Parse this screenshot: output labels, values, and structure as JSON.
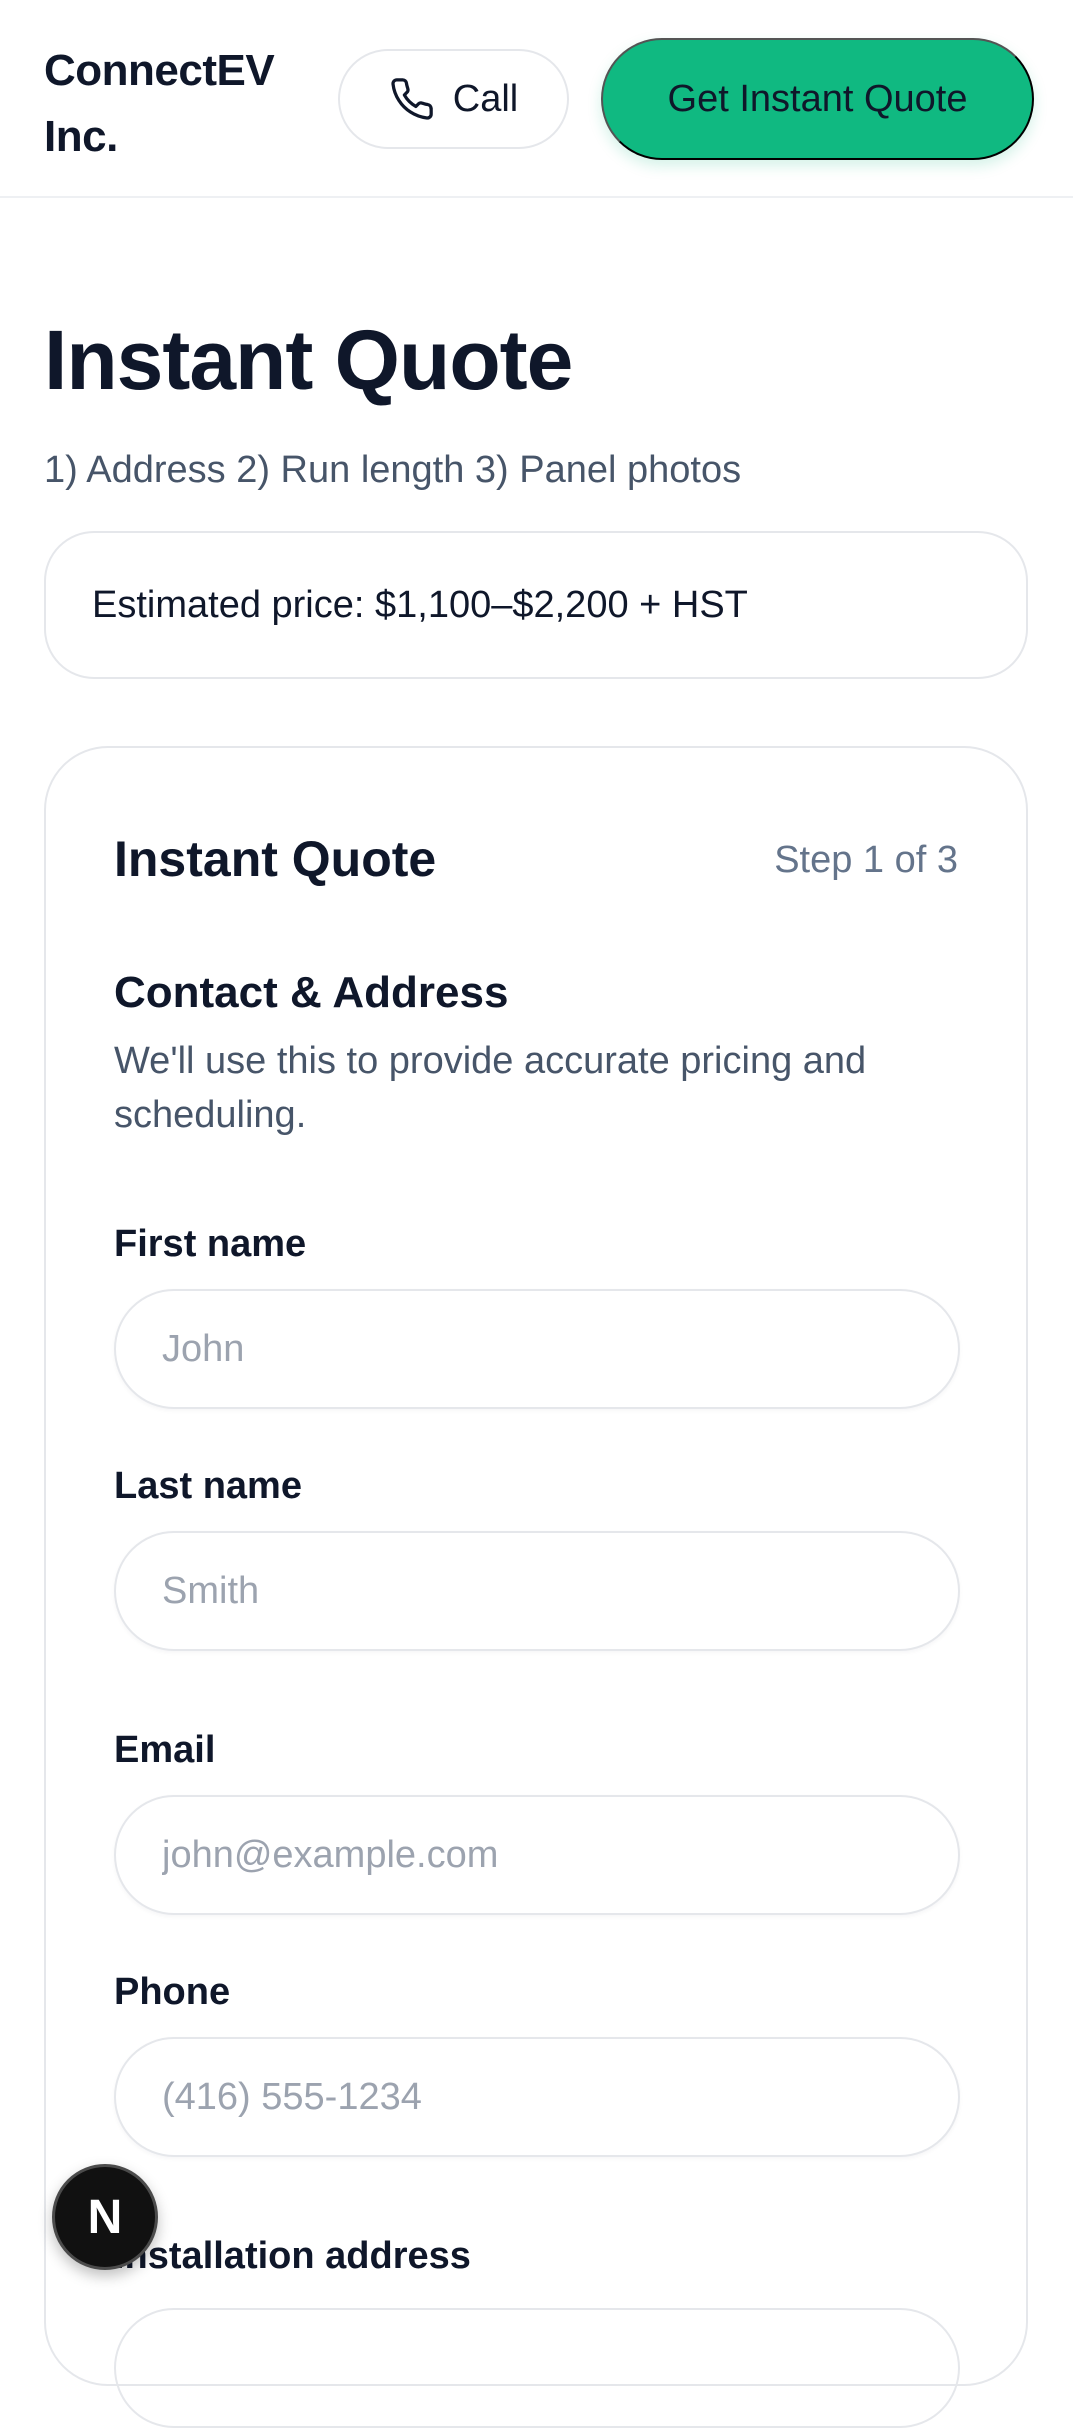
{
  "header": {
    "brand": "ConnectEV Inc.",
    "call_label": "Call",
    "quote_label": "Get Instant Quote"
  },
  "page": {
    "title": "Instant Quote",
    "steps": "1) Address 2) Run length 3) Panel photos",
    "estimated_price": "Estimated price: $1,100–$2,200 + HST"
  },
  "form": {
    "title": "Instant Quote",
    "step": "Step 1 of 3",
    "section_title": "Contact & Address",
    "section_desc": "We'll use this to provide accurate pricing and scheduling.",
    "fields": {
      "first_name": {
        "label": "First name",
        "placeholder": "John",
        "value": ""
      },
      "last_name": {
        "label": "Last name",
        "placeholder": "Smith",
        "value": ""
      },
      "email": {
        "label": "Email",
        "placeholder": "john@example.com",
        "value": ""
      },
      "phone": {
        "label": "Phone",
        "placeholder": "(416) 555-1234",
        "value": ""
      },
      "address": {
        "label": "Installation address"
      }
    }
  },
  "badge": {
    "letter": "N"
  },
  "colors": {
    "accent": "#10b981",
    "text": "#0f172a",
    "muted": "#64748b",
    "border": "#e5e7eb"
  },
  "icons": {
    "call": "phone-icon"
  }
}
